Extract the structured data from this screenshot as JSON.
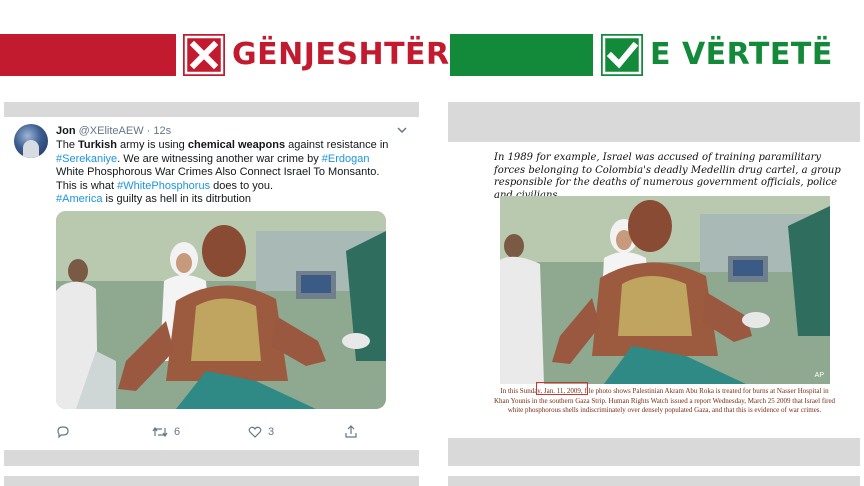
{
  "banner": {
    "false_label": "GËNJESHTËR",
    "true_label": "E VËRTETË",
    "false_icon": "x-mark-icon",
    "true_icon": "check-mark-icon",
    "false_color": "#c21a2e",
    "true_color": "#138a3a"
  },
  "tweet": {
    "name": "Jon",
    "handle": "@XEliteAEW",
    "time": "· 12s",
    "line1_pre": "The ",
    "line1_bold1": "Turkish",
    "line1_mid": " army is using ",
    "line1_bold2": "chemical weapons",
    "line1_post": " against resistance in",
    "line2_tag1": "#Serekaniye",
    "line2_mid": ". We are witnessing another war crime by ",
    "line2_tag2": "#Erdogan",
    "line3": "White Phosphorous War Crimes Also Connect Israel To Monsanto.",
    "line4_pre": "This is what ",
    "line4_tag": "#WhitePhosphorus",
    "line4_post": " does to you.",
    "line5_tag": "#America",
    "line5_post": " is guilty as hell in its ditrbution",
    "actions": {
      "reply_icon": "reply-icon",
      "retweet_icon": "retweet-icon",
      "retweet_count": "6",
      "like_icon": "heart-icon",
      "like_count": "3",
      "share_icon": "share-icon"
    }
  },
  "document": {
    "quote": "In 1989 for example, Israel was accused of training paramilitary forces belonging to Colombia's deadly Medellin drug cartel, a group responsible for the deaths of numerous government officials, police and civilians.",
    "photo_credit": "AP",
    "caption_pre": "In this Sunday, ",
    "caption_date": "Jan. 11, 2009,",
    "caption_post": " file photo shows Palestinian Akram Abu Roka is treated for burns at Nasser Hospital in Khan Younis in the southern Gaza Strip. Human Rights Watch issued a report Wednesday, March 25 2009 that Israel fired white phosphorous shells indiscriminately over densely populated Gaza, and that this is evidence of war crimes.",
    "highlight_color": "#d0342c"
  }
}
